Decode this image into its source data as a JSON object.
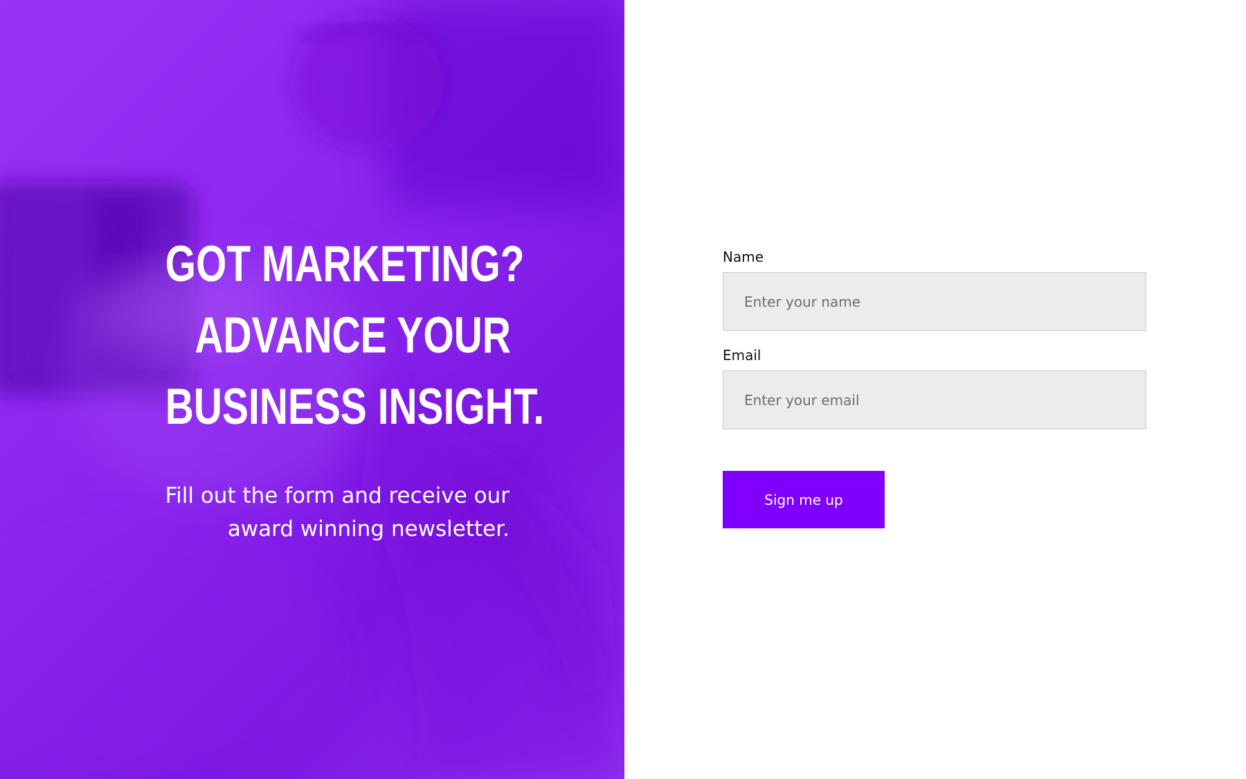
{
  "hero": {
    "headline_lines": [
      "GOT MARKETING?",
      "ADVANCE YOUR",
      "BUSINESS INSIGHT."
    ],
    "subtext": "Fill out the form and receive our award winning newsletter.",
    "background_color": "#9b32f6"
  },
  "form": {
    "name_label": "Name",
    "name_placeholder": "Enter your name",
    "name_value": "",
    "email_label": "Email",
    "email_placeholder": "Enter your email",
    "email_value": "",
    "submit_label": "Sign me up",
    "accent_color": "#7f00ff"
  }
}
